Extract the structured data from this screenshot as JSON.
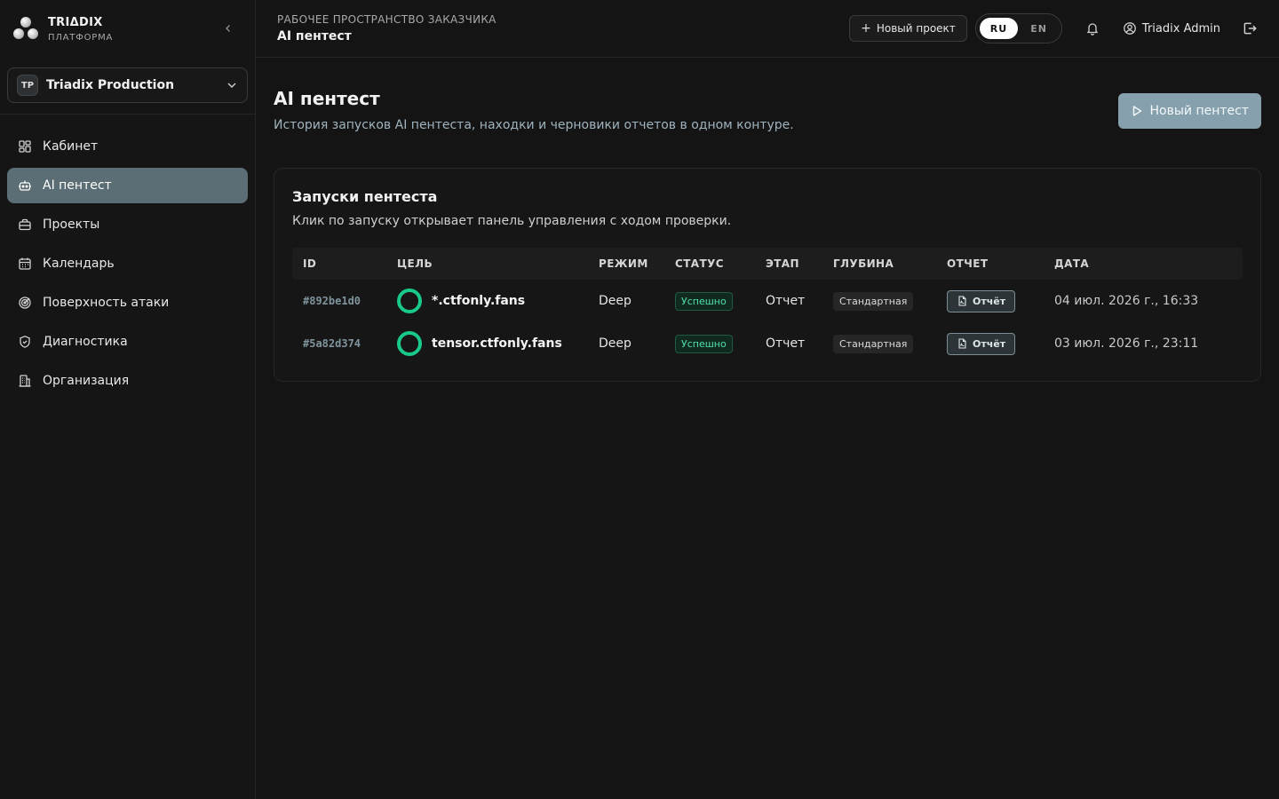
{
  "brand": {
    "name": "TRIΔDIX",
    "subtitle": "ПЛАТФОРМА"
  },
  "workspace": {
    "badge": "TP",
    "name": "Triadix Production"
  },
  "sidebar": {
    "items": [
      {
        "label": "Кабинет",
        "icon": "dashboard-grid-icon"
      },
      {
        "label": "AI пентест",
        "icon": "robot-icon"
      },
      {
        "label": "Проекты",
        "icon": "briefcase-icon"
      },
      {
        "label": "Календарь",
        "icon": "calendar-icon"
      },
      {
        "label": "Поверхность атаки",
        "icon": "target-icon"
      },
      {
        "label": "Диагностика",
        "icon": "shield-icon"
      },
      {
        "label": "Организация",
        "icon": "building-icon"
      }
    ],
    "active_index": 1
  },
  "topbar": {
    "breadcrumb": "РАБОЧЕЕ ПРОСТРАНСТВО ЗАКАЗЧИКА",
    "title": "AI пентест",
    "new_project_label": "Новый проект",
    "lang_ru": "RU",
    "lang_en": "EN",
    "user_name": "Triadix Admin"
  },
  "page": {
    "title": "AI пентест",
    "description": "История запусков AI пентеста, находки и черновики отчетов в одном контуре.",
    "new_pentest_label": "Новый пентест"
  },
  "runs": {
    "title": "Запуски пентеста",
    "description": "Клик по запуску открывает панель управления с ходом проверки.",
    "columns": [
      "ID",
      "ЦЕЛЬ",
      "РЕЖИМ",
      "СТАТУС",
      "ЭТАП",
      "ГЛУБИНА",
      "ОТЧЕТ",
      "ДАТА"
    ],
    "rows": [
      {
        "id": "#892be1d0",
        "target": "*.ctfonly.fans",
        "mode": "Deep",
        "status": "Успешно",
        "stage": "Отчет",
        "depth": "Стандартная",
        "report": "Отчёт",
        "date": "04 июл. 2026 г., 16:33"
      },
      {
        "id": "#5a82d374",
        "target": "tensor.ctfonly.fans",
        "mode": "Deep",
        "status": "Успешно",
        "stage": "Отчет",
        "depth": "Стандартная",
        "report": "Отчёт",
        "date": "03 июл. 2026 г., 23:11"
      }
    ]
  },
  "colors": {
    "accent": "#5b6e76",
    "primary_button": "#86a1ad",
    "success": "#19c98a"
  }
}
